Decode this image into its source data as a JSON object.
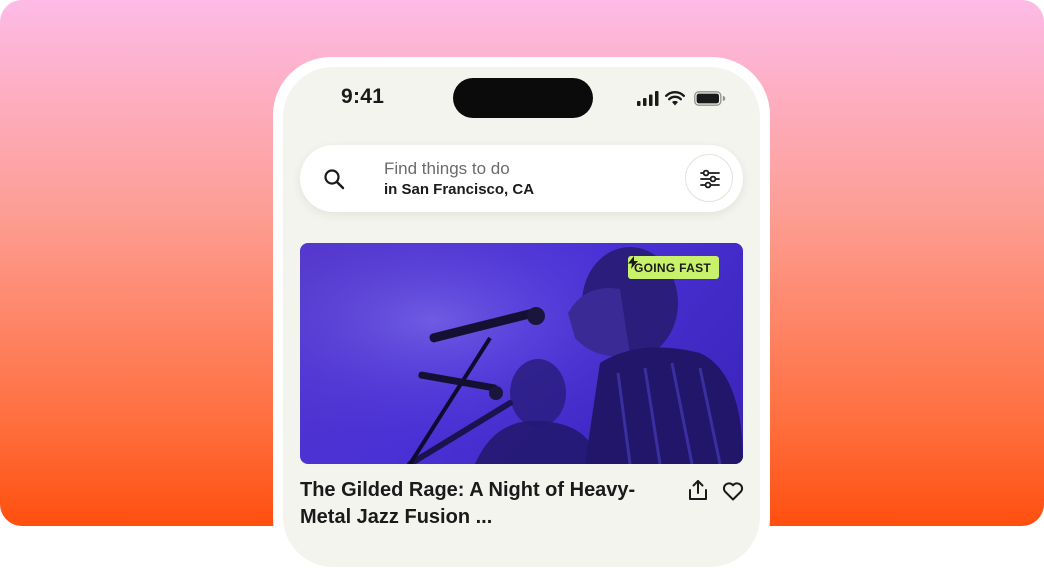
{
  "status_bar": {
    "time": "9:41",
    "icons": [
      "cellular-signal-icon",
      "wifi-icon",
      "battery-icon"
    ]
  },
  "search": {
    "placeholder": "Find things to do",
    "location": "in San Francisco, CA",
    "filter_icon": "filter-sliders-icon"
  },
  "event": {
    "badge": "GOING FAST",
    "badge_icon": "lightning-bolt-icon",
    "title": "The Gilded Rage: A Night of Heavy-Metal Jazz Fusion ...",
    "actions": [
      "share-icon",
      "heart-icon"
    ]
  },
  "colors": {
    "background_top": "#fdbbe6",
    "background_bottom": "#ff4f0f",
    "screen": "#f4f4ee",
    "badge": "#c9f26c",
    "image_tint": "#4a31d6"
  }
}
